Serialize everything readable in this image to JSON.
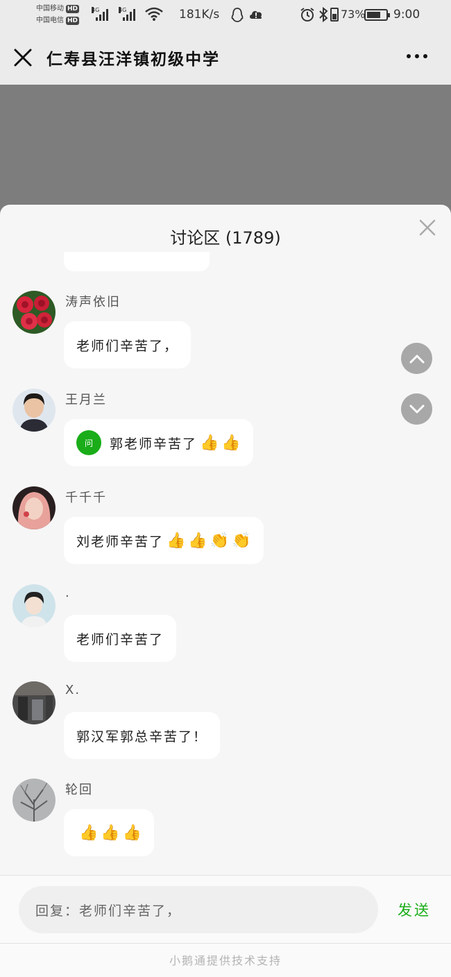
{
  "status_bar": {
    "carrier1": "中国移动",
    "carrier2": "中国电信",
    "hd_label": "HD",
    "network1": "4G",
    "network2": "4G",
    "speed": "181K/s",
    "battery_percent_label": "73%",
    "battery_level": 0.73,
    "time": "9:00"
  },
  "titlebar": {
    "title": "仁寿县汪洋镇初级中学"
  },
  "sheet": {
    "title": "讨论区 (1789)"
  },
  "messages": [
    {
      "user": "涛声依旧",
      "text": "老师们辛苦了，",
      "emojis": []
    },
    {
      "user": "王月兰",
      "badge": "问",
      "text": "郭老师辛苦了",
      "emojis": [
        "👍",
        "👍"
      ]
    },
    {
      "user": "千千千",
      "text": "刘老师辛苦了",
      "emojis": [
        "👍",
        "👍",
        "👏",
        "👏"
      ]
    },
    {
      "user": ".",
      "text": "老师们辛苦了",
      "emojis": []
    },
    {
      "user": "X.",
      "text": "郭汉军郭总辛苦了！",
      "emojis": []
    },
    {
      "user": "轮回",
      "text": "",
      "emojis": [
        "👍",
        "👍",
        "👍"
      ]
    }
  ],
  "footer": {
    "reply_text": "回复：老师们辛苦了，",
    "send_label": "发送",
    "powered_by": "小鹅通提供技术支持"
  },
  "colors": {
    "accent_green": "#1aad19",
    "backdrop": "#7d7d7d",
    "sheet_bg": "#f6f6f6"
  }
}
